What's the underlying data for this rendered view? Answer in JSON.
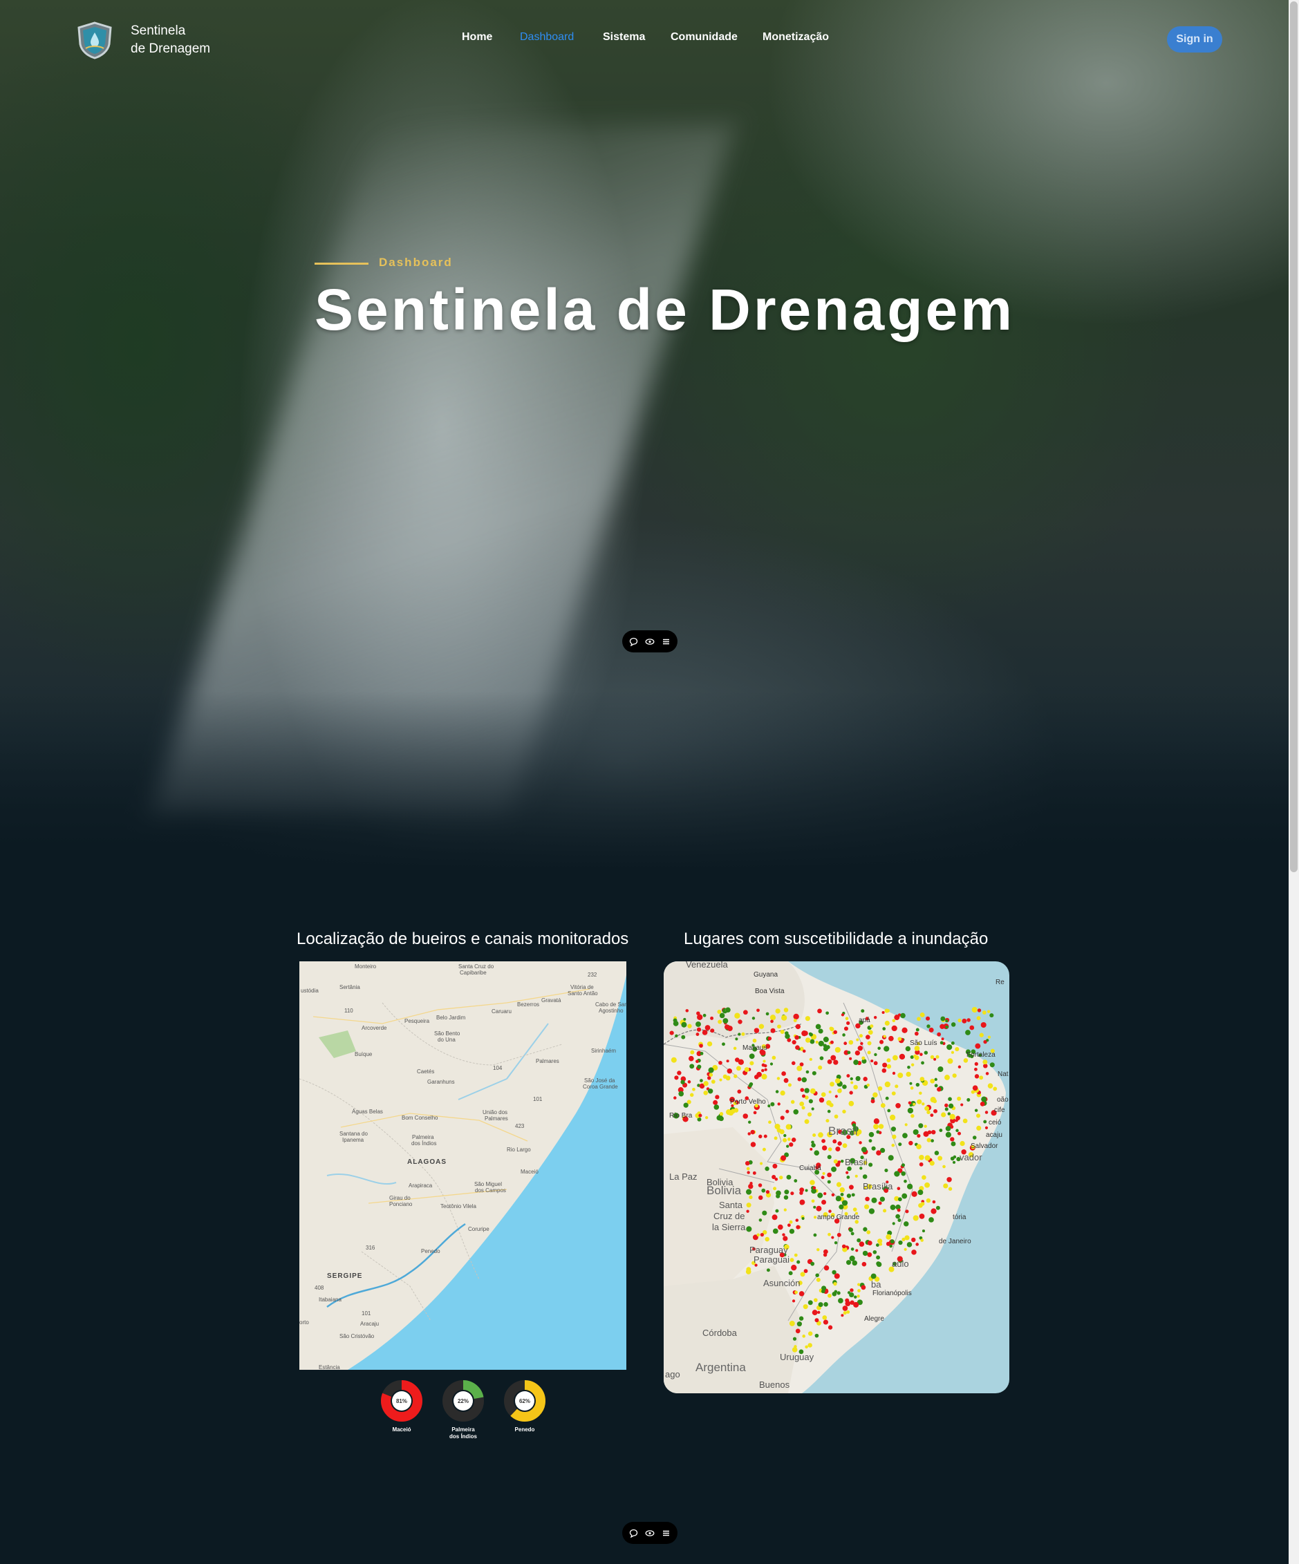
{
  "brand": {
    "line1": "Sentinela",
    "line2": "de Drenagem",
    "logo_icon": "shield-drop-icon"
  },
  "nav": {
    "items": [
      {
        "label": "Home",
        "active": false
      },
      {
        "label": "Dashboard",
        "active": true
      },
      {
        "label": "Sistema",
        "active": false
      },
      {
        "label": "Comunidade",
        "active": false
      },
      {
        "label": "Monetização",
        "active": false
      }
    ],
    "signin_label": "Sign in"
  },
  "hero": {
    "kicker": "Dashboard",
    "title": "Sentinela de Drenagem"
  },
  "floating_menu": {
    "icons": [
      "chat-bubble-icon",
      "eye-icon",
      "menu-icon"
    ]
  },
  "sections": {
    "left_title": "Localização de bueiros e canais monitorados",
    "right_title": "Lugares com suscetibilidade a inundação"
  },
  "left_map": {
    "labels": {
      "monteiro": "Monteiro",
      "santa_cruz": "Santa Cruz do",
      "capibaribe": "Capibaribe",
      "sertania": "Sertânia",
      "custodia": "ustódia",
      "gravata": "Gravatá",
      "vitoria": "Vitória de",
      "santo_antao": "Santo Antão",
      "caruaru": "Caruaru",
      "bezerros": "Bezerros",
      "cabo": "Cabo de Sar",
      "agostinho": "Agostinho",
      "pesqueira": "Pesqueira",
      "belo_jardim": "Belo Jardim",
      "arcoverde": "Arcoverde",
      "sao_bento": "São Bento",
      "do_una": "do Una",
      "sirinhaem": "Sirinhaém",
      "buique": "Buíque",
      "palmares": "Palmares",
      "caetes": "Caetés",
      "garanhuns": "Garanhuns",
      "sao_jose": "São José da",
      "coroa_grande": "Coroa Grande",
      "aguas_belas": "Águas Belas",
      "bom_conselho": "Bom Conselho",
      "uniao": "União dos",
      "palmares2": "Palmares",
      "santana": "Santana do",
      "ipanema": "Ipanema",
      "palmeira": "Palmeira",
      "dos_indios": "dos Índios",
      "alagoas": "ALAGOAS",
      "rio_largo": "Rio Largo",
      "maceio": "Maceió",
      "arapiraca": "Arapiraca",
      "sao_miguel": "São Miguel",
      "dos_campos": "dos Campos",
      "girau": "Girau do",
      "ponciano": "Ponciano",
      "teotonio": "Teotônio Vilela",
      "coruripe": "Coruripe",
      "penedo": "Penedo",
      "sergipe": "SERGIPE",
      "itabaiana": "Itabaiana",
      "aracaju": "Aracaju",
      "sao_cristovao": "São Cristóvão",
      "porto": "orto",
      "estancia": "Estância",
      "r1": "110",
      "r2": "232",
      "r3": "104",
      "r4": "101",
      "r5": "423",
      "r6": "316",
      "r7": "408",
      "r8": "101"
    }
  },
  "right_map": {
    "labels": {
      "venezuela": "Venezuela",
      "guyana": "Guyana",
      "boa_vista": "Boa Vista",
      "macapa": "apá",
      "sao_luis": "São Luís",
      "fortaleza": "Fortaleza",
      "natal": "Nat",
      "manaus": "Manaus",
      "porto_velho": "Porto Velho",
      "rio_branco": "Rio Bra",
      "brasil1": "Brasil",
      "brasil2": "Brasil",
      "joao_pessoa": "oão",
      "recife": "cife",
      "maceio": "ceió",
      "aracaju": "acaju",
      "salvador": "Salvador",
      "salvador2": "vador",
      "cuiaba": "Cuiabá",
      "brasilia": "Brasília",
      "la_paz": "La Paz",
      "bolivia1": "Bolivia",
      "bolivia2": "Bolivia",
      "santa_cruz1": "Santa",
      "santa_cruz2": "Cruz de",
      "santa_cruz3": "la Sierra",
      "campo_grande": "ampo Grande",
      "vitoria": "tória",
      "rio": "de Janeiro",
      "sao_paulo": "aulo",
      "paraguay1": "Paraguay",
      "paraguay2": "Paraguai",
      "asuncion": "Asunción",
      "curitiba": "ba",
      "florianopolis": "Florianópolis",
      "cordoba": "Córdoba",
      "porto_alegre": "Alegre",
      "argentina": "Argentina",
      "uruguay": "Uruguay",
      "buenos": "Buenos",
      "ago": "ago",
      "re": "Re"
    }
  },
  "gauges": [
    {
      "name": "Maceió",
      "percent": 81,
      "label": "81%",
      "color": "#ee1c1c"
    },
    {
      "name": "Palmeira dos Índios",
      "name1": "Palmeira",
      "name2": "dos Índios",
      "percent": 22,
      "label": "22%",
      "color": "#5bb04a"
    },
    {
      "name": "Penedo",
      "percent": 62,
      "label": "62%",
      "color": "#f5c518"
    }
  ],
  "colors": {
    "accent_blue": "#2f8ef4",
    "kicker_gold": "#e6c15a",
    "page_bg": "#0c1a22",
    "sea": "#7ccfef"
  }
}
